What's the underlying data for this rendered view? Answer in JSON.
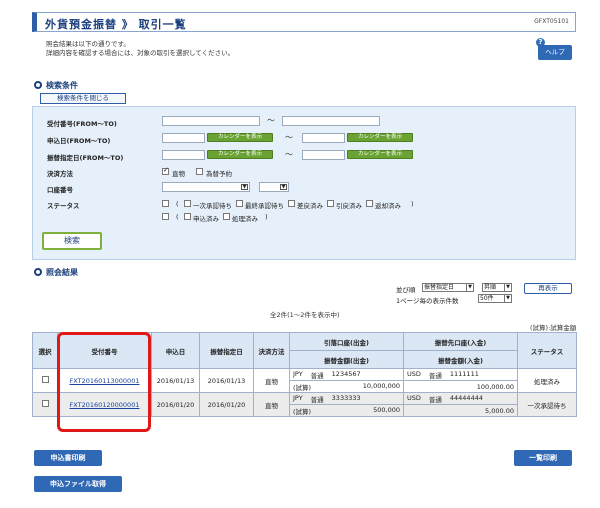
{
  "header": {
    "title": "外貨預金振替 》 取引一覧",
    "screen_id": "GFXT05101"
  },
  "intro": {
    "line1": "照会結果は以下の通りです。",
    "line2": "詳細内容を確認する場合には、対象の取引を選択してください。"
  },
  "help": {
    "icon": "?",
    "label": "ヘルプ"
  },
  "search": {
    "section_title": "検索条件",
    "toggle_label": "検索条件を閉じる",
    "labels": {
      "ref_no": "受付番号(FROM〜TO)",
      "apply_date": "申込日(FROM〜TO)",
      "transfer_date": "振替指定日(FROM〜TO)",
      "settlement": "決済方法",
      "account": "口座番号",
      "status": "ステータス"
    },
    "tilde": "〜",
    "calendar_label": "カレンダーを表示",
    "settlement_options": [
      "直物",
      "為替予約"
    ],
    "status_row1": [
      "(",
      "一次承認待ち",
      "最終承認待ち",
      "差戻済み",
      "引戻済み",
      "返却済み",
      ")"
    ],
    "status_row2": [
      "(",
      "申込済み",
      "処理済み",
      ")"
    ],
    "submit_label": "検索"
  },
  "results": {
    "section_title": "照会結果",
    "sort_label": "並び順",
    "sort_key": "振替指定日",
    "sort_order": "昇順",
    "per_page_label": "1ページ毎の表示件数",
    "per_page": "50件",
    "redisplay_label": "再表示",
    "count_text": "全2件(1〜2件を表示中)",
    "unit_text": "(試算):試算金額",
    "columns": {
      "select": "選択",
      "ref_no": "受付番号",
      "apply_date": "申込日",
      "transfer_date": "振替指定日",
      "settlement": "決済方法",
      "debit_account": "引落口座(出金)",
      "debit_amount": "振替金額(出金)",
      "credit_account": "振替先口座(入金)",
      "credit_amount": "振替金額(入金)",
      "status": "ステータス"
    },
    "rows": [
      {
        "ref_no": "FXT20160113000001",
        "apply_date": "2016/01/13",
        "transfer_date": "2016/01/13",
        "settlement": "直物",
        "debit_ccy": "JPY",
        "debit_type": "普通",
        "debit_no": "1234567",
        "debit_trial": "(試算)",
        "debit_amount": "10,000,000",
        "credit_ccy": "USD",
        "credit_type": "普通",
        "credit_no": "1111111",
        "credit_amount": "100,000.00",
        "status": "処理済み"
      },
      {
        "ref_no": "FXT20160120000001",
        "apply_date": "2016/01/20",
        "transfer_date": "2016/01/20",
        "settlement": "直物",
        "debit_ccy": "JPY",
        "debit_type": "普通",
        "debit_no": "3333333",
        "debit_trial": "(試算)",
        "debit_amount": "500,000",
        "credit_ccy": "USD",
        "credit_type": "普通",
        "credit_no": "44444444",
        "credit_amount": "5,000.00",
        "status": "一次承認待ち"
      }
    ]
  },
  "footer": {
    "print_application": "申込書印刷",
    "print_list": "一覧印刷",
    "get_file": "申込ファイル取得"
  },
  "colors": {
    "primary": "#2f68b5",
    "calendar": "#6aa334",
    "highlight": "#e01818",
    "panel": "#e6f0fa"
  }
}
